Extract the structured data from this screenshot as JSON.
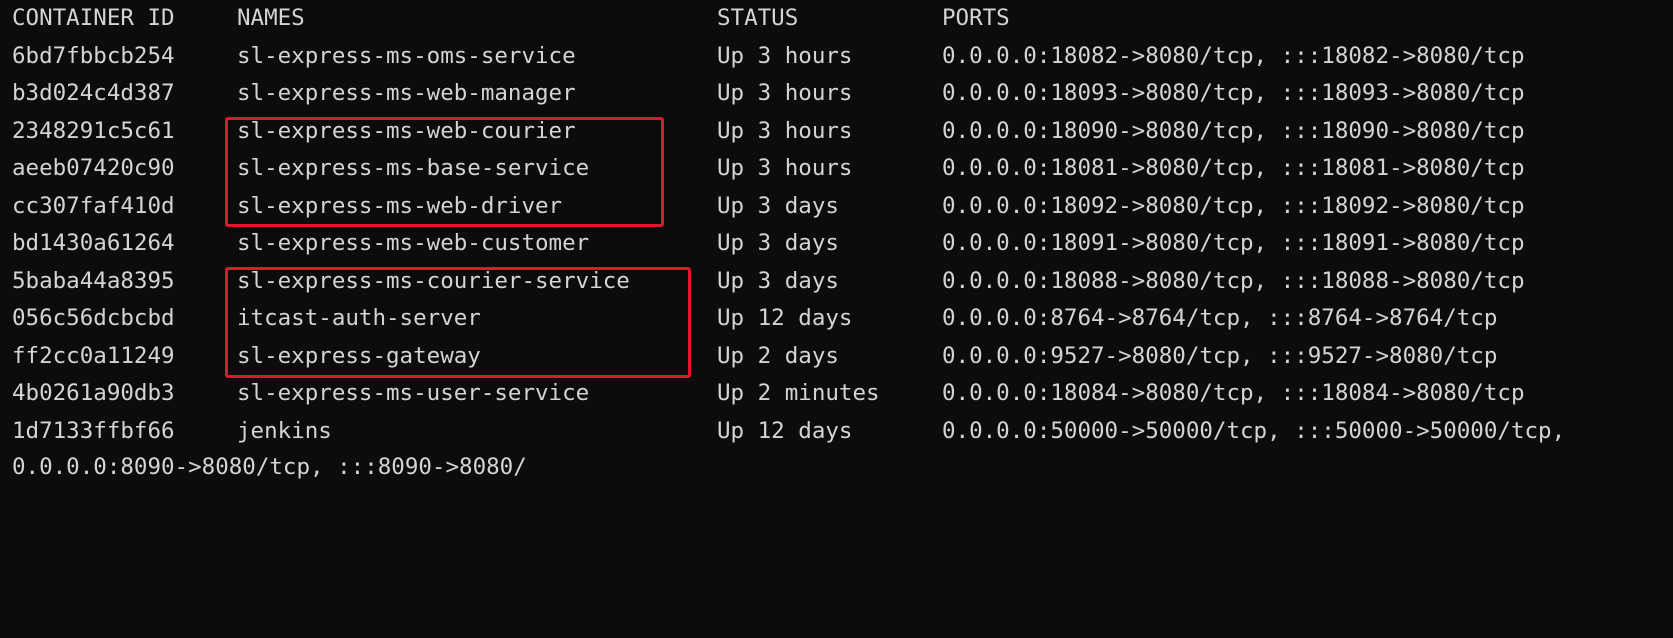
{
  "terminal": {
    "headers": {
      "id": "CONTAINER ID",
      "names": "NAMES",
      "status": "STATUS",
      "ports": "PORTS"
    },
    "rows": [
      {
        "id": "6bd7fbbcb254",
        "name": "sl-express-ms-oms-service",
        "status": "Up 3 hours",
        "ports": "0.0.0.0:18082->8080/tcp, :::18082->8080/tcp"
      },
      {
        "id": "b3d024c4d387",
        "name": "sl-express-ms-web-manager",
        "status": "Up 3 hours",
        "ports": "0.0.0.0:18093->8080/tcp, :::18093->8080/tcp"
      },
      {
        "id": "2348291c5c61",
        "name": "sl-express-ms-web-courier",
        "status": "Up 3 hours",
        "ports": "0.0.0.0:18090->8080/tcp, :::18090->8080/tcp"
      },
      {
        "id": "aeeb07420c90",
        "name": "sl-express-ms-base-service",
        "status": "Up 3 hours",
        "ports": "0.0.0.0:18081->8080/tcp, :::18081->8080/tcp"
      },
      {
        "id": "cc307faf410d",
        "name": "sl-express-ms-web-driver",
        "status": "Up 3 days",
        "ports": "0.0.0.0:18092->8080/tcp, :::18092->8080/tcp"
      },
      {
        "id": "bd1430a61264",
        "name": "sl-express-ms-web-customer",
        "status": "Up 3 days",
        "ports": "0.0.0.0:18091->8080/tcp, :::18091->8080/tcp"
      },
      {
        "id": "5baba44a8395",
        "name": "sl-express-ms-courier-service",
        "status": "Up 3 days",
        "ports": "0.0.0.0:18088->8080/tcp, :::18088->8080/tcp"
      },
      {
        "id": "056c56dcbcbd",
        "name": "itcast-auth-server",
        "status": "Up 12 days",
        "ports": "0.0.0.0:8764->8764/tcp, :::8764->8764/tcp"
      },
      {
        "id": "ff2cc0a11249",
        "name": "sl-express-gateway",
        "status": "Up 2 days",
        "ports": "0.0.0.0:9527->8080/tcp, :::9527->8080/tcp"
      },
      {
        "id": "4b0261a90db3",
        "name": "sl-express-ms-user-service",
        "status": "Up 2 minutes",
        "ports": "0.0.0.0:18084->8080/tcp, :::18084->8080/tcp"
      },
      {
        "id": "1d7133ffbf66",
        "name": "jenkins",
        "status": "Up 12 days",
        "ports": "0.0.0.0:50000->50000/tcp, :::50000->50000/tcp,"
      }
    ],
    "partial_line": "0.0.0.0:8090->8080/tcp, :::8090->8080/",
    "highlight_color": "#e0182f"
  }
}
